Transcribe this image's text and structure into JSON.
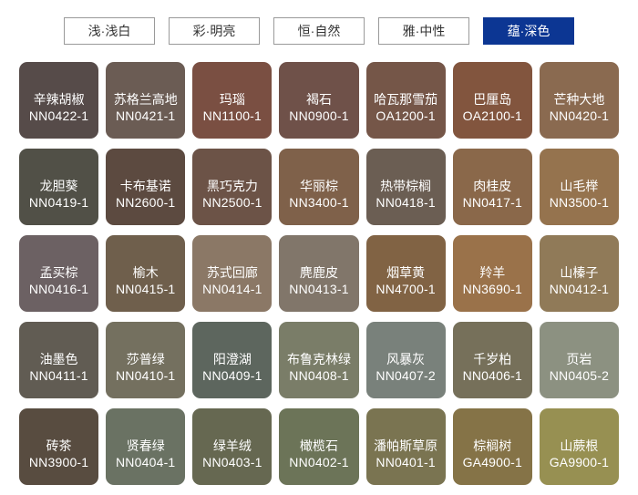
{
  "page": {
    "background": "#ffffff"
  },
  "tabs": {
    "active_bg": "#0c3693",
    "active_text": "#ffffff",
    "inactive_border": "#9a9a9a",
    "inactive_text": "#333333",
    "items": [
      {
        "label": "浅·浅白",
        "active": false
      },
      {
        "label": "彩·明亮",
        "active": false
      },
      {
        "label": "恒·自然",
        "active": false
      },
      {
        "label": "雅·中性",
        "active": false
      },
      {
        "label": "蕴·深色",
        "active": true
      }
    ]
  },
  "swatches": [
    {
      "name": "辛辣胡椒",
      "code": "NN0422-1",
      "color": "#564b49"
    },
    {
      "name": "苏格兰高地",
      "code": "NN0421-1",
      "color": "#6b5c54"
    },
    {
      "name": "玛瑙",
      "code": "NN1100-1",
      "color": "#7a4f42"
    },
    {
      "name": "褐石",
      "code": "NN0900-1",
      "color": "#6f5149"
    },
    {
      "name": "哈瓦那雪茄",
      "code": "OA1200-1",
      "color": "#755648"
    },
    {
      "name": "巴厘岛",
      "code": "OA2100-1",
      "color": "#82553e"
    },
    {
      "name": "芒种大地",
      "code": "NN0420-1",
      "color": "#8a6a50"
    },
    {
      "name": "龙胆葵",
      "code": "NN0419-1",
      "color": "#515047"
    },
    {
      "name": "卡布基诺",
      "code": "NN2600-1",
      "color": "#5c4a40"
    },
    {
      "name": "黑巧克力",
      "code": "NN2500-1",
      "color": "#6c5347"
    },
    {
      "name": "华丽棕",
      "code": "NN3400-1",
      "color": "#7f614a"
    },
    {
      "name": "热带棕榈",
      "code": "NN0418-1",
      "color": "#6b5e53"
    },
    {
      "name": "肉桂皮",
      "code": "NN0417-1",
      "color": "#8a684a"
    },
    {
      "name": "山毛榉",
      "code": "NN3500-1",
      "color": "#95734e"
    },
    {
      "name": "孟买棕",
      "code": "NN0416-1",
      "color": "#6c6163"
    },
    {
      "name": "榆木",
      "code": "NN0415-1",
      "color": "#6f5f4c"
    },
    {
      "name": "苏式回廊",
      "code": "NN0414-1",
      "color": "#8b7866"
    },
    {
      "name": "麂鹿皮",
      "code": "NN0413-1",
      "color": "#81766a"
    },
    {
      "name": "烟草黄",
      "code": "NN4700-1",
      "color": "#816344"
    },
    {
      "name": "羚羊",
      "code": "NN3690-1",
      "color": "#9a724a"
    },
    {
      "name": "山榛子",
      "code": "NN0412-1",
      "color": "#907a58"
    },
    {
      "name": "油墨色",
      "code": "NN0411-1",
      "color": "#615c53"
    },
    {
      "name": "莎普绿",
      "code": "NN0410-1",
      "color": "#74705f"
    },
    {
      "name": "阳澄湖",
      "code": "NN0409-1",
      "color": "#5d665e"
    },
    {
      "name": "布鲁克林绿",
      "code": "NN0408-1",
      "color": "#7a7d68"
    },
    {
      "name": "风暴灰",
      "code": "NN0407-2",
      "color": "#79817b"
    },
    {
      "name": "千岁柏",
      "code": "NN0406-1",
      "color": "#76705a"
    },
    {
      "name": "页岩",
      "code": "NN0405-2",
      "color": "#8c9181"
    },
    {
      "name": "砖茶",
      "code": "NN3900-1",
      "color": "#584c40"
    },
    {
      "name": "贤春绿",
      "code": "NN0404-1",
      "color": "#6a7263"
    },
    {
      "name": "绿羊绒",
      "code": "NN0403-1",
      "color": "#666851"
    },
    {
      "name": "橄榄石",
      "code": "NN0402-1",
      "color": "#6c7458"
    },
    {
      "name": "潘帕斯草原",
      "code": "NN0401-1",
      "color": "#7a7451"
    },
    {
      "name": "棕榈树",
      "code": "GA4900-1",
      "color": "#857347"
    },
    {
      "name": "山蕨根",
      "code": "GA9900-1",
      "color": "#979052"
    }
  ]
}
